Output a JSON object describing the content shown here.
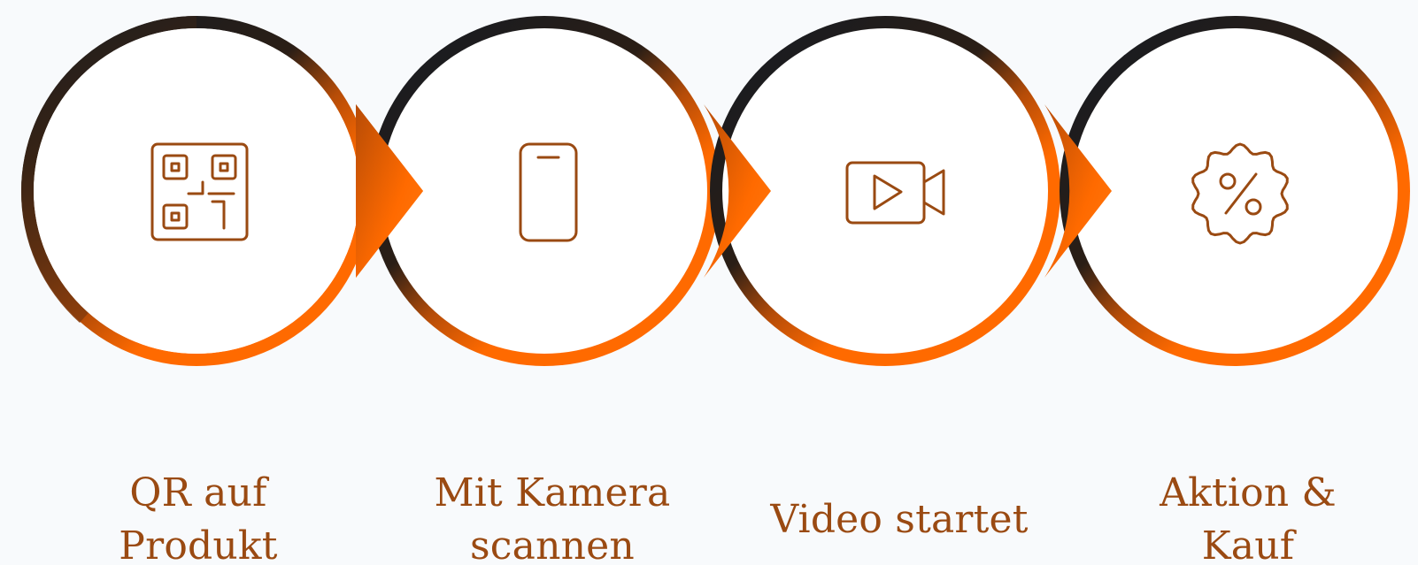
{
  "colors": {
    "background": "#f8fafc",
    "ring_dark": "#1a1c20",
    "ring_orange": "#ff6a00",
    "ring_brown": "#7a3a0e",
    "icon_stroke": "#9a4a12",
    "label_text": "#9a4a12"
  },
  "steps": [
    {
      "icon": "qr-code-icon",
      "label_line1": "QR auf",
      "label_line2": "Produkt"
    },
    {
      "icon": "smartphone-icon",
      "label_line1": "Mit Kamera",
      "label_line2": "scannen"
    },
    {
      "icon": "video-camera-icon",
      "label_line1": "Video startet",
      "label_line2": ""
    },
    {
      "icon": "discount-badge-icon",
      "label_line1": "Aktion &",
      "label_line2": "Kauf"
    }
  ]
}
